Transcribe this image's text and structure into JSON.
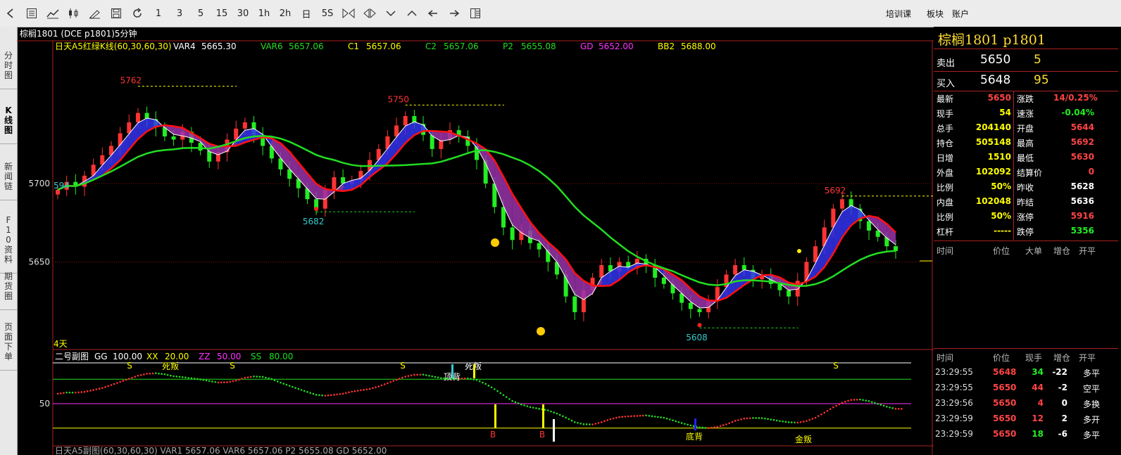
{
  "toolbar": {
    "periods": [
      "1",
      "3",
      "5",
      "15",
      "30",
      "1h",
      "2h",
      "日",
      "5S"
    ],
    "menu": [
      "培训课",
      "板块",
      "账户"
    ]
  },
  "leftnav": [
    "分时图",
    "K线图",
    "新闻链",
    "F10资料",
    "期货圈",
    "页面下单"
  ],
  "main_chart": {
    "header": "棕榈1801 (DCE p1801)5分钟",
    "indicator_name": "日天A5红绿K线(60,30,60,30)",
    "indicators": [
      {
        "name": "VAR4",
        "value": "5665.30",
        "name_color": "#ffffff",
        "value_color": "#ffffff"
      },
      {
        "name": "VAR6",
        "value": "5657.06",
        "name_color": "#22dd22",
        "value_color": "#22dd22"
      },
      {
        "name": "C1",
        "value": "5657.06",
        "name_color": "#ffff00",
        "value_color": "#ffff00"
      },
      {
        "name": "C2",
        "value": "5657.06",
        "name_color": "#22dd22",
        "value_color": "#22dd22"
      },
      {
        "name": "P2",
        "value": "5655.08",
        "name_color": "#22dd22",
        "value_color": "#22dd22"
      },
      {
        "name": "GD",
        "value": "5652.00",
        "name_color": "#ff33ff",
        "value_color": "#ff33ff"
      },
      {
        "name": "BB2",
        "value": "5688.00",
        "name_color": "#ffff00",
        "value_color": "#ffff00"
      }
    ],
    "y_labels": [
      "5700",
      "5650"
    ],
    "peak_labels": [
      "5762",
      "5750",
      "5692"
    ],
    "trough_labels": [
      "5682",
      "5608"
    ],
    "left_edge_label": "594",
    "period_label": "4天"
  },
  "chart_data": {
    "type": "candlestick",
    "ylim": [
      5596,
      5782
    ],
    "y_ticks": [
      5700,
      5650
    ],
    "series": [
      {
        "name": "close",
        "values": [
          5696,
          5701,
          5698,
          5705,
          5712,
          5718,
          5724,
          5732,
          5739,
          5745,
          5741,
          5736,
          5730,
          5728,
          5733,
          5726,
          5721,
          5714,
          5720,
          5728,
          5735,
          5739,
          5731,
          5724,
          5716,
          5709,
          5703,
          5697,
          5690,
          5684,
          5696,
          5704,
          5700,
          5702,
          5708,
          5715,
          5722,
          5730,
          5737,
          5743,
          5738,
          5731,
          5722,
          5728,
          5734,
          5730,
          5724,
          5715,
          5700,
          5685,
          5672,
          5664,
          5670,
          5662,
          5658,
          5650,
          5642,
          5628,
          5618,
          5632,
          5640,
          5648,
          5644,
          5650,
          5646,
          5652,
          5648,
          5640,
          5636,
          5630,
          5624,
          5620,
          5618,
          5625,
          5634,
          5642,
          5648,
          5645,
          5639,
          5641,
          5636,
          5632,
          5628,
          5638,
          5650,
          5660,
          5672,
          5684,
          5690,
          5684,
          5676,
          5670,
          5666,
          5660,
          5657
        ]
      }
    ]
  },
  "sub_chart": {
    "name": "二号副图",
    "params": [
      {
        "name": "GG",
        "value": "100.00",
        "color": "#ffffff"
      },
      {
        "name": "XX",
        "value": "20.00",
        "color": "#ffff00"
      },
      {
        "name": "ZZ",
        "value": "50.00",
        "color": "#ff33ff"
      },
      {
        "name": "SS",
        "value": "80.00",
        "color": "#22dd22"
      }
    ],
    "y_label": "50",
    "signals": [
      "S",
      "死叛",
      "S",
      "S",
      "顶背",
      "死叛",
      "S",
      "B",
      "B",
      "底背",
      "金叛"
    ],
    "bottom_text": "日天A5副图(60,30,60,30)  VAR1  5657.06  VAR6  5657.06  P2  5655.08  GD  5652.00"
  },
  "quote": {
    "title": "棕榈1801 p1801",
    "sell_label": "卖出",
    "sell_price": "5650",
    "sell_vol": "5",
    "buy_label": "买入",
    "buy_price": "5648",
    "buy_vol": "95",
    "rows": [
      {
        "l1": "最新",
        "v1": "5650",
        "c1": "#ff4444",
        "l2": "涨跌",
        "v2": "14/0.25%",
        "c2": "#ff4444"
      },
      {
        "l1": "现手",
        "v1": "54",
        "c1": "#ffff00",
        "l2": "速涨",
        "v2": "-0.04%",
        "c2": "#22ee22"
      },
      {
        "l1": "总手",
        "v1": "204140",
        "c1": "#ffff00",
        "l2": "开盘",
        "v2": "5644",
        "c2": "#ff4444"
      },
      {
        "l1": "持仓",
        "v1": "505148",
        "c1": "#ffff00",
        "l2": "最高",
        "v2": "5692",
        "c2": "#ff4444"
      },
      {
        "l1": "日增",
        "v1": "1510",
        "c1": "#ffff00",
        "l2": "最低",
        "v2": "5630",
        "c2": "#ff4444"
      },
      {
        "l1": "外盘",
        "v1": "102092",
        "c1": "#ffff00",
        "l2": "结算价",
        "v2": "0",
        "c2": "#ff4444"
      },
      {
        "l1": "比例",
        "v1": "50%",
        "c1": "#ffff00",
        "l2": "昨收",
        "v2": "5628",
        "c2": "#ffffff"
      },
      {
        "l1": "内盘",
        "v1": "102048",
        "c1": "#ffff00",
        "l2": "昨结",
        "v2": "5636",
        "c2": "#ffffff"
      },
      {
        "l1": "比例",
        "v1": "50%",
        "c1": "#ffff00",
        "l2": "涨停",
        "v2": "5916",
        "c2": "#ff4444"
      },
      {
        "l1": "杠杆",
        "v1": "-----",
        "c1": "#ffff00",
        "l2": "跌停",
        "v2": "5356",
        "c2": "#22ee22"
      }
    ],
    "tick_header1": [
      "时间",
      "价位",
      "大单",
      "增仓",
      "开平"
    ],
    "tick_header2": [
      "时间",
      "价位",
      "现手",
      "增仓",
      "开平"
    ],
    "ticks": [
      {
        "time": "23:29:55",
        "price": "5648",
        "vol": "34",
        "chg": "-22",
        "type": "多平",
        "pc": "#ff4444",
        "vc": "#22ee22",
        "cc": "#ffffff",
        "tc": "#ffffff"
      },
      {
        "time": "23:29:55",
        "price": "5650",
        "vol": "44",
        "chg": "-2",
        "type": "空平",
        "pc": "#ff4444",
        "vc": "#ff4444",
        "cc": "#ffffff",
        "tc": "#ffffff"
      },
      {
        "time": "23:29:56",
        "price": "5650",
        "vol": "4",
        "chg": "0",
        "type": "多换",
        "pc": "#ff4444",
        "vc": "#ff4444",
        "cc": "#ffffff",
        "tc": "#ffffff"
      },
      {
        "time": "23:29:59",
        "price": "5650",
        "vol": "12",
        "chg": "2",
        "type": "多开",
        "pc": "#ff4444",
        "vc": "#ff4444",
        "cc": "#ffffff",
        "tc": "#ffffff"
      },
      {
        "time": "23:29:59",
        "price": "5650",
        "vol": "18",
        "chg": "-6",
        "type": "多平",
        "pc": "#ff4444",
        "vc": "#22ee22",
        "cc": "#ffffff",
        "tc": "#ffffff"
      }
    ]
  }
}
